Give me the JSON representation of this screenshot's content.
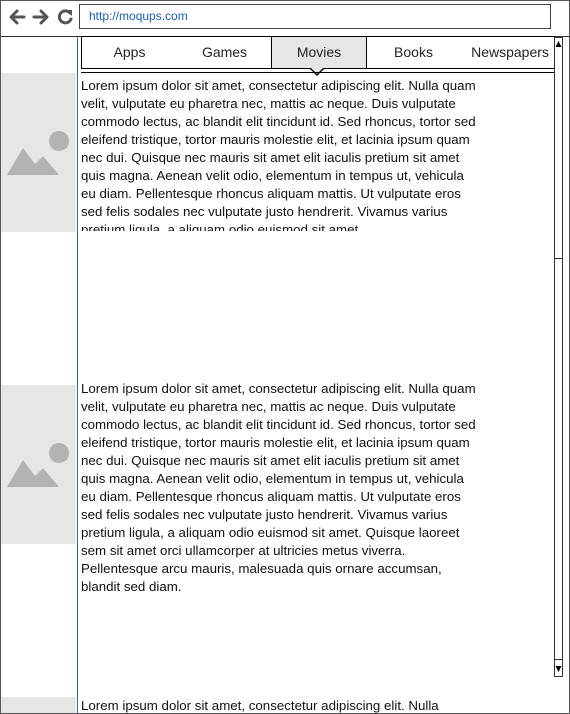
{
  "browser": {
    "url": "http://moqups.com",
    "back_icon": "arrow-left-icon",
    "forward_icon": "arrow-right-icon",
    "refresh_icon": "refresh-icon"
  },
  "tabs": [
    {
      "label": "Apps"
    },
    {
      "label": "Games"
    },
    {
      "label": "Movies",
      "selected": true
    },
    {
      "label": "Books"
    },
    {
      "label": "Newspapers"
    }
  ],
  "articles": [
    {
      "image_icon": "image-placeholder-icon",
      "text": "Lorem ipsum dolor sit amet, consectetur adipiscing elit. Nulla quam velit, vulputate eu pharetra nec, mattis ac neque. Duis vulputate commodo lectus, ac blandit elit tincidunt id. Sed rhoncus, tortor sed eleifend tristique, tortor mauris molestie elit, et lacinia ipsum quam nec dui. Quisque nec mauris sit amet elit iaculis pretium sit amet quis magna. Aenean velit odio, elementum in tempus ut, vehicula eu diam. Pellentesque rhoncus aliquam mattis. Ut vulputate eros sed felis sodales nec vulputate justo hendrerit. Vivamus varius pretium ligula, a aliquam odio euismod sit amet."
    },
    {
      "image_icon": "image-placeholder-icon",
      "text": "Lorem ipsum dolor sit amet, consectetur adipiscing elit. Nulla quam velit, vulputate eu pharetra nec, mattis ac neque. Duis vulputate commodo lectus, ac blandit elit tincidunt id. Sed rhoncus, tortor sed eleifend tristique, tortor mauris molestie elit, et lacinia ipsum quam nec dui. Quisque nec mauris sit amet elit iaculis pretium sit amet quis magna. Aenean velit odio, elementum in tempus ut, vehicula eu diam. Pellentesque rhoncus aliquam mattis. Ut vulputate eros sed felis sodales nec vulputate justo hendrerit. Vivamus varius pretium ligula, a aliquam odio euismod sit amet. Quisque laoreet sem sit amet orci ullamcorper at ultricies metus viverra. Pellentesque arcu mauris, malesuada quis ornare accumsan, blandit sed diam."
    },
    {
      "image_icon": "image-placeholder-icon",
      "text": "Lorem ipsum dolor sit amet, consectetur adipiscing elit. Nulla"
    }
  ],
  "colors": {
    "accent": "#2d6db3",
    "placeholder": "#e6e6e6",
    "selected_tab": "#e6e6e6"
  }
}
